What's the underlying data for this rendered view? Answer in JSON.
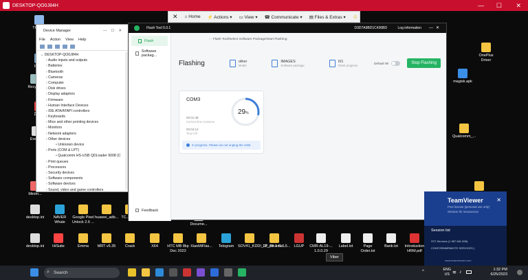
{
  "remote": {
    "title": "DESKTOP-QO0J84H",
    "min": "—",
    "max": "☐",
    "close": "✕"
  },
  "toolbar": {
    "home": "Home",
    "actions": "Actions",
    "view": "View",
    "communicate": "Communicate",
    "files": "Files & Extras"
  },
  "desktop_icons": [
    {
      "label": "This PC",
      "color": "#8fb9ea"
    },
    {
      "label": "Rec...",
      "color": "#7aa6c9"
    },
    {
      "label": "Recycl...",
      "color": "#9bb"
    },
    {
      "label": "百度...",
      "color": "#e44"
    },
    {
      "label": "Every...",
      "color": "#ddd"
    },
    {
      "label": "Minim...",
      "color": "#e66"
    },
    {
      "label": "desktop.ini",
      "color": "#ddd"
    },
    {
      "label": "NAVER Whale",
      "color": "#2aa2d8"
    },
    {
      "label": "Google Pixel Unlock 2.6 ...",
      "color": "#f4c542"
    },
    {
      "label": "huawei_adb...",
      "color": "#f4c542"
    },
    {
      "label": "TC... ONE",
      "color": "#f4c542"
    },
    {
      "label": "Docume...",
      "color": "#ddd"
    },
    {
      "label": "desktop.ini",
      "color": "#ddd"
    },
    {
      "label": "HiSuite",
      "color": "#f44"
    },
    {
      "label": "Emma",
      "color": "#f4c542"
    },
    {
      "label": "MRT v5.35",
      "color": "#f4c542"
    },
    {
      "label": "Crack",
      "color": "#f4c542"
    },
    {
      "label": "X64",
      "color": "#f4c542"
    },
    {
      "label": "HTC MB 8kp Dec 2022",
      "color": "#f4c542"
    },
    {
      "label": "XiaoMiFlas...",
      "color": "#f4c542"
    },
    {
      "label": "Telegram",
      "color": "#2aa2d8"
    },
    {
      "label": "SOV41_KDDI_JP_55.1.C.0.5...",
      "color": "#f4c542"
    },
    {
      "label": "12_zte-eme...",
      "color": "#f4c542"
    },
    {
      "label": "LGUP",
      "color": "#c33"
    },
    {
      "label": "CMR-AL19-... 1.0.0.29",
      "color": "#eee"
    },
    {
      "label": "Label.txt",
      "color": "#eee"
    },
    {
      "label": "Page Order.txt",
      "color": "#eee"
    },
    {
      "label": "Bank.txt",
      "color": "#eee"
    },
    {
      "label": "Introduction HRM.pdf",
      "color": "#d33"
    },
    {
      "label": "OnePlus Driver",
      "color": "#f4c542"
    },
    {
      "label": "magisk.apk",
      "color": "#3a8ee6"
    },
    {
      "label": "Qualcomm_...",
      "color": "#f4c542"
    },
    {
      "label": "Sample_FRP... Lo Flash Tool",
      "color": "#f4c542"
    }
  ],
  "devmgr": {
    "title": "Device Manager",
    "menus": [
      "File",
      "Action",
      "View",
      "Help"
    ],
    "tree": [
      {
        "t": "DESKTOP-QO0J84H",
        "lvl": 0
      },
      {
        "t": "Audio inputs and outputs",
        "lvl": 1
      },
      {
        "t": "Batteries",
        "lvl": 1
      },
      {
        "t": "Bluetooth",
        "lvl": 1
      },
      {
        "t": "Cameras",
        "lvl": 1
      },
      {
        "t": "Computer",
        "lvl": 1
      },
      {
        "t": "Disk drives",
        "lvl": 1
      },
      {
        "t": "Display adaptors",
        "lvl": 1
      },
      {
        "t": "Firmware",
        "lvl": 1
      },
      {
        "t": "Human Interface Devices",
        "lvl": 1
      },
      {
        "t": "IDE ATA/ATAPI controllers",
        "lvl": 1
      },
      {
        "t": "Keyboards",
        "lvl": 1
      },
      {
        "t": "Mice and other pointing devices",
        "lvl": 1
      },
      {
        "t": "Monitors",
        "lvl": 1
      },
      {
        "t": "Network adapters",
        "lvl": 1
      },
      {
        "t": "Other devices",
        "lvl": 1
      },
      {
        "t": "Unknown device",
        "lvl": 2
      },
      {
        "t": "Ports (COM & LPT)",
        "lvl": 1
      },
      {
        "t": "Qualcomm HS-USB QDLoader 9008 (C",
        "lvl": 2
      },
      {
        "t": "Print queues",
        "lvl": 1
      },
      {
        "t": "Processors",
        "lvl": 1
      },
      {
        "t": "Security devices",
        "lvl": 1
      },
      {
        "t": "Software components",
        "lvl": 1
      },
      {
        "t": "Software devices",
        "lvl": 1
      },
      {
        "t": "Sound, video and game controllers",
        "lvl": 1
      }
    ]
  },
  "flash": {
    "title": "Flash Tool 5.0.1",
    "user": "D3D7A9BD1C436BD",
    "login": "Log information",
    "breadcrumb": "Flash Tool/Select Software Package/Start Flashing",
    "nav": {
      "flash": "Flash",
      "software": "Software packag...",
      "feedback": "Feedback"
    },
    "heading": "Flashing",
    "stats": [
      {
        "v": "other",
        "l": "Model"
      },
      {
        "v": "IMAGES",
        "l": "Software package"
      },
      {
        "v": "0/1",
        "l": "Flash progress"
      }
    ],
    "default_wi": "Default Wi",
    "stop_btn": "Stop Flashing",
    "card": {
      "port": "COM3",
      "percent_label": "29",
      "percent_sign": "%",
      "progress": 0.29,
      "elapsed": "00:01:38",
      "elapsed_label": "Current time consume",
      "left": "00:04:12",
      "left_label": "Time left",
      "info": "In progress. Please do not unplug the USB."
    }
  },
  "teamviewer": {
    "brand": "TeamViewer",
    "line1": "Free license (personal use only)",
    "line2": "Session ID: 5xxxxxxxxx",
    "session_title": "Session list",
    "rows": [
      "ST2 Services (1 987 661 838)",
      "CONFORMMRIMOTE SERVICES ("
    ],
    "link": "www.teamviewer.com"
  },
  "taskbar": {
    "search": "Search",
    "lang1": "ENG",
    "lang2": "US",
    "time": "1:32 PM",
    "date": "6/25/2023",
    "tooltip": "Viber"
  }
}
